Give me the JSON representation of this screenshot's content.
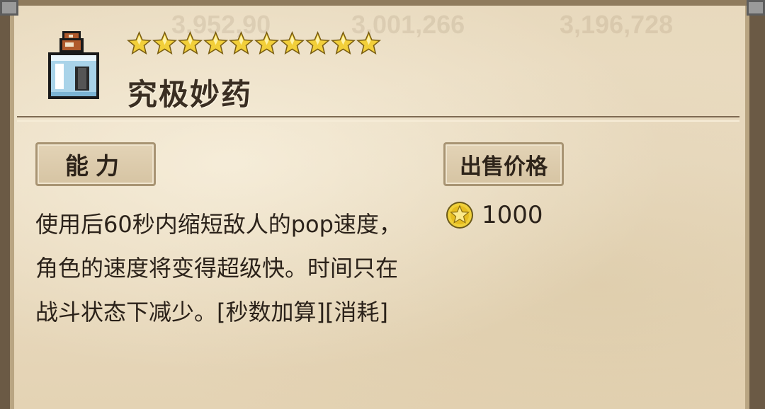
{
  "item": {
    "name": "究极妙药",
    "star_count": 10,
    "icon": "potion-bottle-icon"
  },
  "ability": {
    "label": "能力",
    "description": "使用后60秒内缩短敌人的pop速度，角色的速度将变得超级快。时间只在战斗状态下减少。[秒数加算][消耗]"
  },
  "sell": {
    "label": "出售价格",
    "price": "1000",
    "currency_icon": "gold-coin-icon"
  },
  "background_ghost_text": [
    "3,952,90",
    "3,001,266",
    "3,196,728"
  ],
  "colors": {
    "star": "#f2cf3a",
    "parchment": "#e8d9bd",
    "coin": "#f0d03a"
  }
}
